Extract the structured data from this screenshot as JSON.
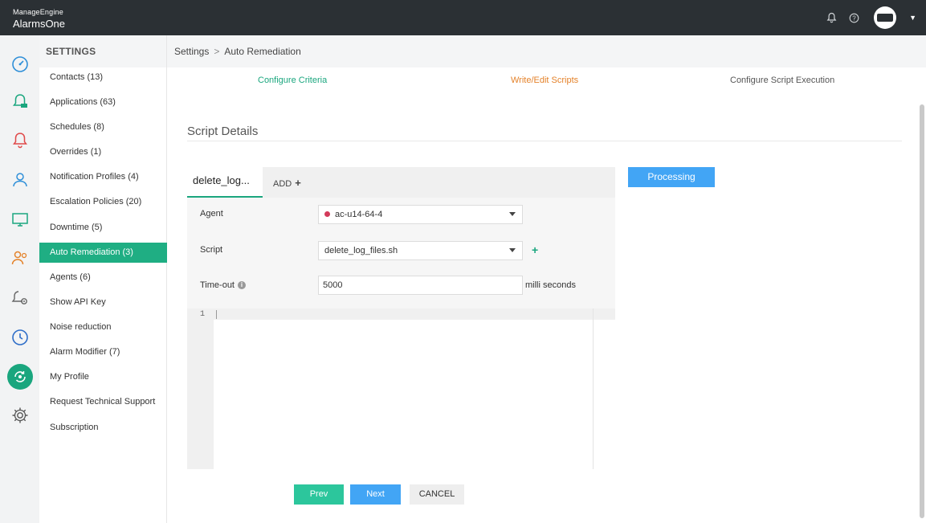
{
  "app": {
    "vendor": "ManageEngine",
    "name": "AlarmsOne"
  },
  "header": {
    "icons": [
      "bell-icon",
      "help-icon"
    ],
    "avatar_text": "",
    "breadcrumb": {
      "root": "Settings",
      "current": "Auto Remediation"
    }
  },
  "rail": {
    "icons": [
      "dashboard-icon",
      "alarm-live-icon",
      "alarm-icon",
      "user-icon",
      "monitor-icon",
      "users-icon",
      "alarm-settings-icon",
      "clock-icon",
      "remediation-icon",
      "gear-icon"
    ],
    "active": "remediation-icon",
    "accent": "#1aa67e"
  },
  "settings": {
    "title": "SETTINGS",
    "items": [
      {
        "label": "Contacts (13)"
      },
      {
        "label": "Applications (63)"
      },
      {
        "label": "Schedules (8)"
      },
      {
        "label": "Overrides (1)"
      },
      {
        "label": "Notification Profiles (4)"
      },
      {
        "label": "Escalation Policies (20)"
      },
      {
        "label": "Downtime (5)"
      },
      {
        "label": "Auto Remediation (3)",
        "active": true
      },
      {
        "label": "Agents (6)"
      },
      {
        "label": "Show API Key"
      },
      {
        "label": "Noise reduction"
      },
      {
        "label": "Alarm Modifier (7)"
      },
      {
        "label": "My Profile"
      },
      {
        "label": "Request Technical Support"
      },
      {
        "label": "Subscription"
      }
    ]
  },
  "steps": [
    {
      "label": "Configure Criteria",
      "state": "done",
      "color": "#1aa67e"
    },
    {
      "label": "Write/Edit Scripts",
      "state": "current",
      "color": "#e4822a"
    },
    {
      "label": "Configure Script Execution",
      "state": "pending",
      "color": "#555555"
    }
  ],
  "section": {
    "title": "Script Details"
  },
  "editor": {
    "file_tab": "delete_log...",
    "add_label": "ADD",
    "agent": {
      "label": "Agent",
      "value": "ac-u14-64-4",
      "status_color": "#d33b5a"
    },
    "script": {
      "label": "Script",
      "value": "delete_log_files.sh"
    },
    "timeout": {
      "label": "Time-out",
      "value": "5000",
      "unit": "milli seconds"
    },
    "line_numbers": [
      "1"
    ],
    "code": ""
  },
  "processing_label": "Processing",
  "buttons": {
    "prev": "Prev",
    "next": "Next",
    "cancel": "CANCEL"
  }
}
